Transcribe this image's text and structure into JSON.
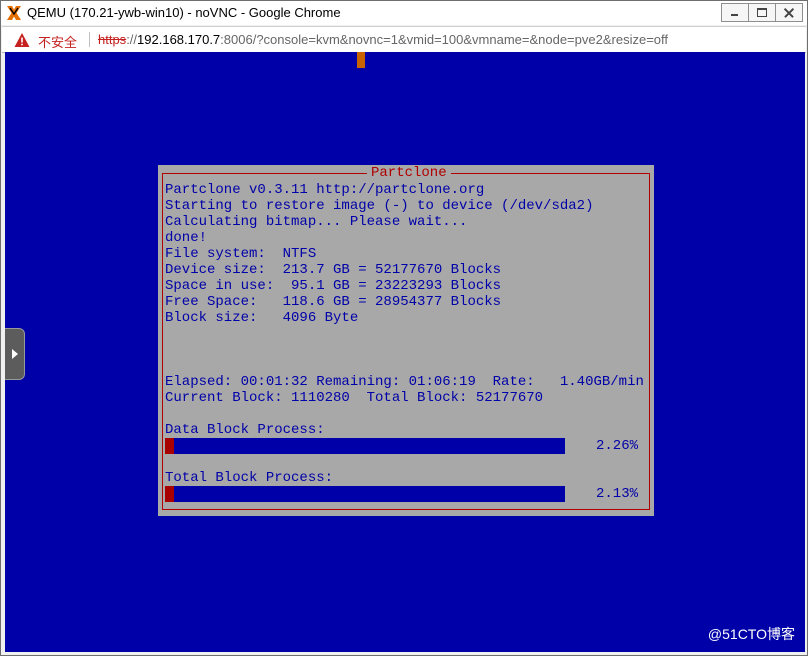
{
  "window": {
    "title": "QEMU (170.21-ywb-win10) - noVNC - Google Chrome",
    "icon": "proxmox-x-icon",
    "controls": [
      "minimize-icon",
      "maximize-icon",
      "close-icon"
    ]
  },
  "addressbar": {
    "security_label": "不安全",
    "url_scheme": "https",
    "url_sep": "://",
    "url_host": "192.168.170.7",
    "url_rest": ":8006/?console=kvm&novnc=1&vmid=100&vmname=&node=pve2&resize=off"
  },
  "partclone": {
    "title": "Partclone",
    "lines": [
      "Partclone v0.3.11 http://partclone.org",
      "Starting to restore image (-) to device (/dev/sda2)",
      "Calculating bitmap... Please wait...",
      "done!",
      "File system:  NTFS",
      "Device size:  213.7 GB = 52177670 Blocks",
      "Space in use:  95.1 GB = 23223293 Blocks",
      "Free Space:   118.6 GB = 28954377 Blocks",
      "Block size:   4096 Byte"
    ],
    "status_lines": [
      "Elapsed: 00:01:32 Remaining: 01:06:19  Rate:   1.40GB/min",
      "Current Block: 1110280  Total Block: 52177670"
    ],
    "data_block": {
      "label": "Data Block Process:",
      "percent_text": "2.26%",
      "fraction": 0.0226
    },
    "total_block": {
      "label": "Total Block Process:",
      "percent_text": "2.13%",
      "fraction": 0.0213
    }
  },
  "watermark": "@51CTO博客",
  "colors": {
    "screen_bg": "#0000a8",
    "dialog_bg": "#a8a8a8",
    "text": "#0000a8",
    "accent_red": "#b00000",
    "bar_fill": "#a80000"
  }
}
